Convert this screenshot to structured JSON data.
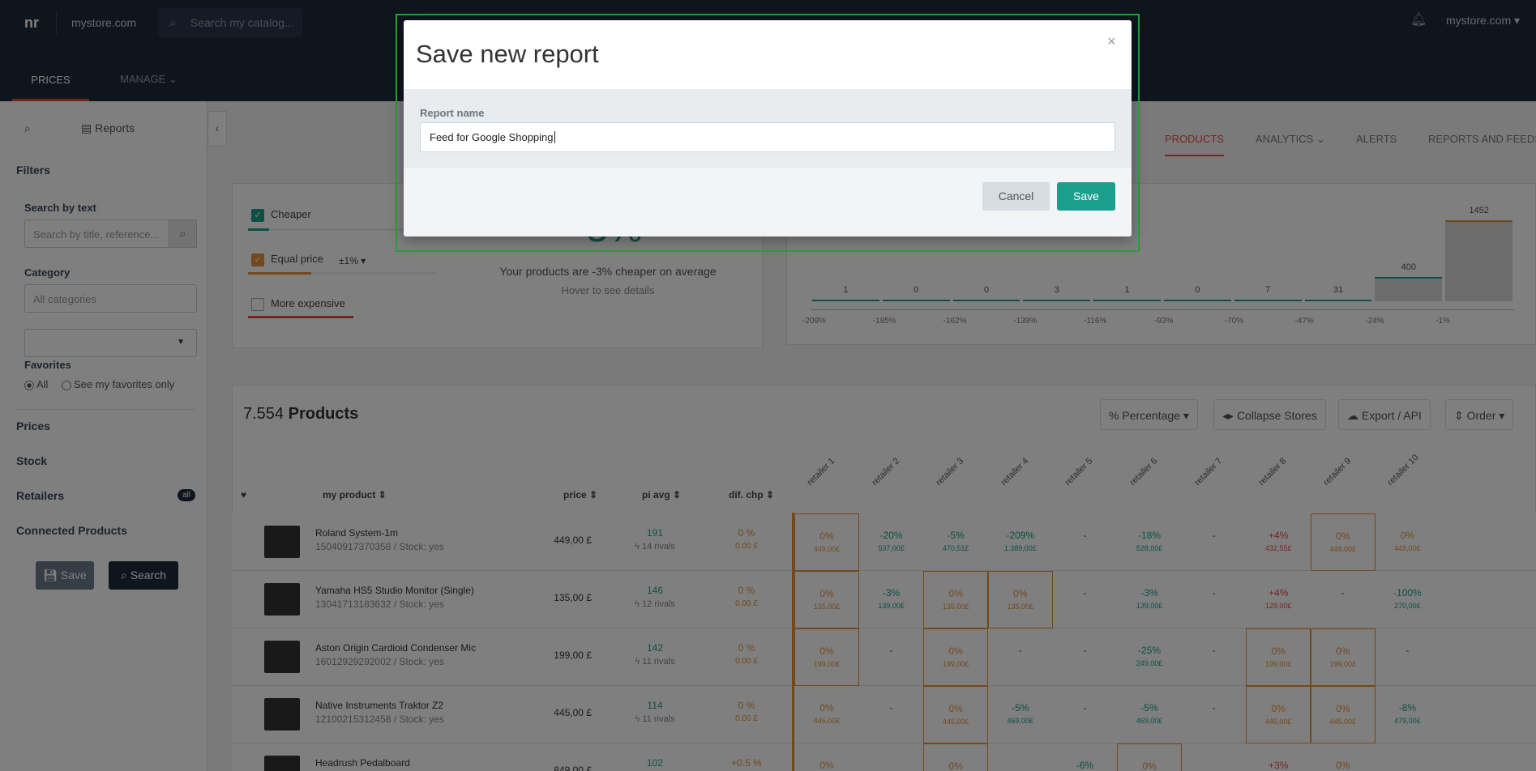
{
  "topbar": {
    "logo": "nr",
    "store": "mystore.com",
    "search_placeholder": "Search my catalog...",
    "store_right": "mystore.com ▾",
    "nav": {
      "prices": "PRICES",
      "manage": "MANAGE ⌄"
    }
  },
  "sidebar": {
    "reports": "Reports",
    "filters": "Filters",
    "search_by_text": "Search by text",
    "search_placeholder": "Search by title, reference...",
    "category": "Category",
    "category_value": "All categories",
    "favorites": "Favorites",
    "fav_all": "All",
    "fav_mine": "See my favorites only",
    "prices": "Prices",
    "stock": "Stock",
    "retailers": "Retailers",
    "retailers_badge": "all",
    "connected": "Connected Products",
    "save": "Save",
    "search": "Search"
  },
  "tabs": {
    "products": "PRODUCTS",
    "analytics": "ANALYTICS ⌄",
    "alerts": "ALERTS",
    "reports": "REPORTS AND FEEDS"
  },
  "filters": {
    "cheaper": "Cheaper",
    "equal": "Equal price",
    "equal_tol": "±1% ▾",
    "expensive": "More expensive",
    "summary": "Your products are -3% cheaper on average",
    "hover": "Hover to see details",
    "big_value": "-3%"
  },
  "histogram": {
    "bars": [
      {
        "label": "1",
        "axis": "-209%",
        "value": 1
      },
      {
        "label": "0",
        "axis": "-185%",
        "value": 0
      },
      {
        "label": "0",
        "axis": "-162%",
        "value": 0
      },
      {
        "label": "3",
        "axis": "-139%",
        "value": 3
      },
      {
        "label": "1",
        "axis": "-116%",
        "value": 1
      },
      {
        "label": "0",
        "axis": "-93%",
        "value": 0
      },
      {
        "label": "7",
        "axis": "-70%",
        "value": 7
      },
      {
        "label": "31",
        "axis": "-47%",
        "value": 31
      },
      {
        "label": "400",
        "axis": "-24%",
        "value": 400
      },
      {
        "label": "1452",
        "axis": "-1%",
        "value": 1452
      }
    ]
  },
  "products": {
    "count": "7.554",
    "title": "Products",
    "buttons": {
      "percentage": "% Percentage ▾",
      "collapse": "◂▸ Collapse Stores",
      "export": "☁ Export / API",
      "order": "⇕ Order ▾"
    },
    "headers": {
      "my_product": "my product ⇕",
      "price": "price ⇕",
      "pi_avg": "pi avg ⇕",
      "dif_chp": "dif. chp ⇕"
    },
    "retailers": [
      "retailer 1",
      "retailer 2",
      "retailer 3",
      "retailer 4",
      "retailer 5",
      "retailer 6",
      "retailer 7",
      "retailer 8",
      "retailer 9",
      "retailer 10"
    ],
    "rows": [
      {
        "name": "Roland System-1m",
        "ref": "15040917370358 / Stock: yes",
        "price": "449,00 £",
        "pi": "191",
        "rivals": "ϟ 14 rivals",
        "dif": "0 %",
        "difsub": "0.00 £"
      },
      {
        "name": "Yamaha HS5 Studio Monitor (Single)",
        "ref": "13041713183632 / Stock: yes",
        "price": "135,00 £",
        "pi": "146",
        "rivals": "ϟ 12 rivals",
        "dif": "0 %",
        "difsub": "0.00 £"
      },
      {
        "name": "Aston Origin Cardioid Condenser Mic",
        "ref": "16012929292002 / Stock: yes",
        "price": "199,00 £",
        "pi": "142",
        "rivals": "ϟ 11 rivals",
        "dif": "0 %",
        "difsub": "0.00 £"
      },
      {
        "name": "Native Instruments Traktor Z2",
        "ref": "12100215312458 / Stock: yes",
        "price": "445,00 £",
        "pi": "114",
        "rivals": "ϟ 11 rivals",
        "dif": "0 %",
        "difsub": "0.00 £"
      },
      {
        "name": "Headrush Pedalboard",
        "ref": "",
        "price": "849,00 £",
        "pi": "102",
        "rivals": "",
        "dif": "+0.5 %",
        "difsub": ""
      }
    ]
  },
  "modal": {
    "title": "Save new report",
    "close": "×",
    "label": "Report name",
    "value": "Feed for Google Shopping",
    "cancel": "Cancel",
    "save": "Save"
  }
}
